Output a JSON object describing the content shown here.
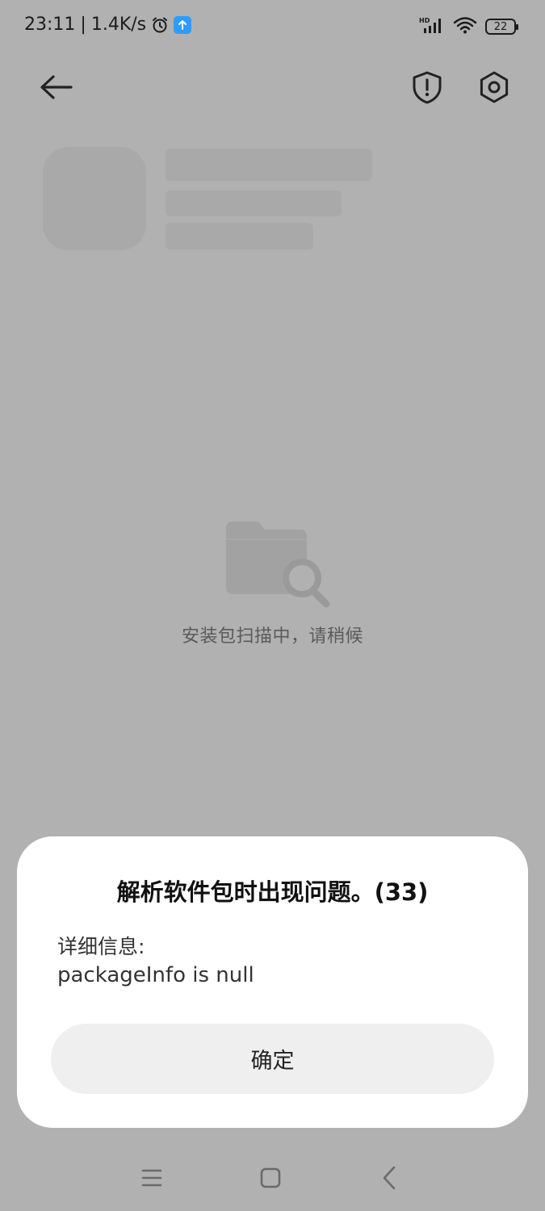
{
  "status_bar": {
    "time": "23:11",
    "separator": "|",
    "net_speed": "1.4K/s",
    "battery": "22",
    "icons": [
      "alarm-icon",
      "upload-icon",
      "signal-hd-icon",
      "wifi-icon",
      "battery-icon"
    ]
  },
  "app_bar": {
    "icons": [
      "back-arrow-icon",
      "shield-exclamation-icon",
      "gear-icon"
    ]
  },
  "main": {
    "scanning_text": "安装包扫描中，请稍候"
  },
  "dialog": {
    "title": "解析软件包时出现问题。(33)",
    "detail_label": "详细信息:",
    "detail_value": "packageInfo is null",
    "confirm_label": "确定"
  },
  "nav_bar": {
    "icons": [
      "menu-icon",
      "home-icon",
      "back-icon"
    ]
  },
  "colors": {
    "overlay": "#b1b1b1",
    "dialog_bg": "#ffffff",
    "button_bg": "#efefef",
    "status_accent": "#2f9bff"
  }
}
